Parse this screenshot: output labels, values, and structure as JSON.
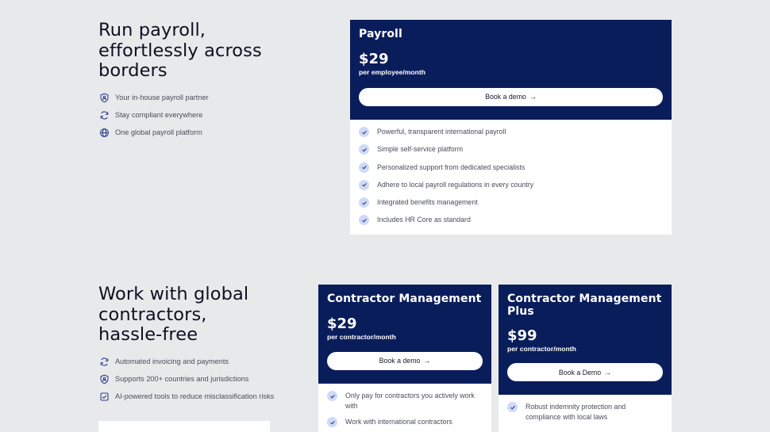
{
  "payroll_section": {
    "heading_lines": [
      "Run payroll,",
      "effortlessly across",
      "borders"
    ],
    "features": [
      {
        "icon": "shield-person-icon",
        "label": "Your in-house payroll partner"
      },
      {
        "icon": "refresh-icon",
        "label": "Stay compliant everywhere"
      },
      {
        "icon": "globe-icon",
        "label": "One global payroll platform"
      }
    ],
    "card": {
      "title": "Payroll",
      "price": "$29",
      "unit": "per employee/month",
      "cta": "Book a demo",
      "benefits": [
        "Powerful, transparent international payroll",
        "Simple self-service platform",
        "Personalized support from dedicated specialists",
        "Adhere to local payroll regulations in every country",
        "Integrated benefits management",
        "Includes HR Core as standard"
      ]
    }
  },
  "contractor_section": {
    "heading_lines": [
      "Work with global",
      "contractors,",
      "hassle-free"
    ],
    "features": [
      {
        "icon": "refresh-icon",
        "label": "Automated invoicing and payments"
      },
      {
        "icon": "shield-person-icon",
        "label": "Supports 200+ countries and jurisdictions"
      },
      {
        "icon": "checklist-icon",
        "label": "AI-powered tools to reduce misclassification risks"
      }
    ],
    "cards": [
      {
        "title": "Contractor Management",
        "price": "$29",
        "unit": "per contractor/month",
        "cta": "Book a demo",
        "benefits": [
          "Only pay for contractors you actively work with",
          "Work with international contractors"
        ]
      },
      {
        "title": "Contractor Management Plus",
        "price": "$99",
        "unit": "per contractor/month",
        "cta": "Book a Demo",
        "benefits": [
          "Robust indemnity protection and compliance with local laws"
        ]
      }
    ]
  },
  "colors": {
    "background": "#e8e9eb",
    "card_header": "#0a1d5b",
    "check_circle": "#cfdaf6",
    "icon_accent": "#2c3a8a"
  }
}
